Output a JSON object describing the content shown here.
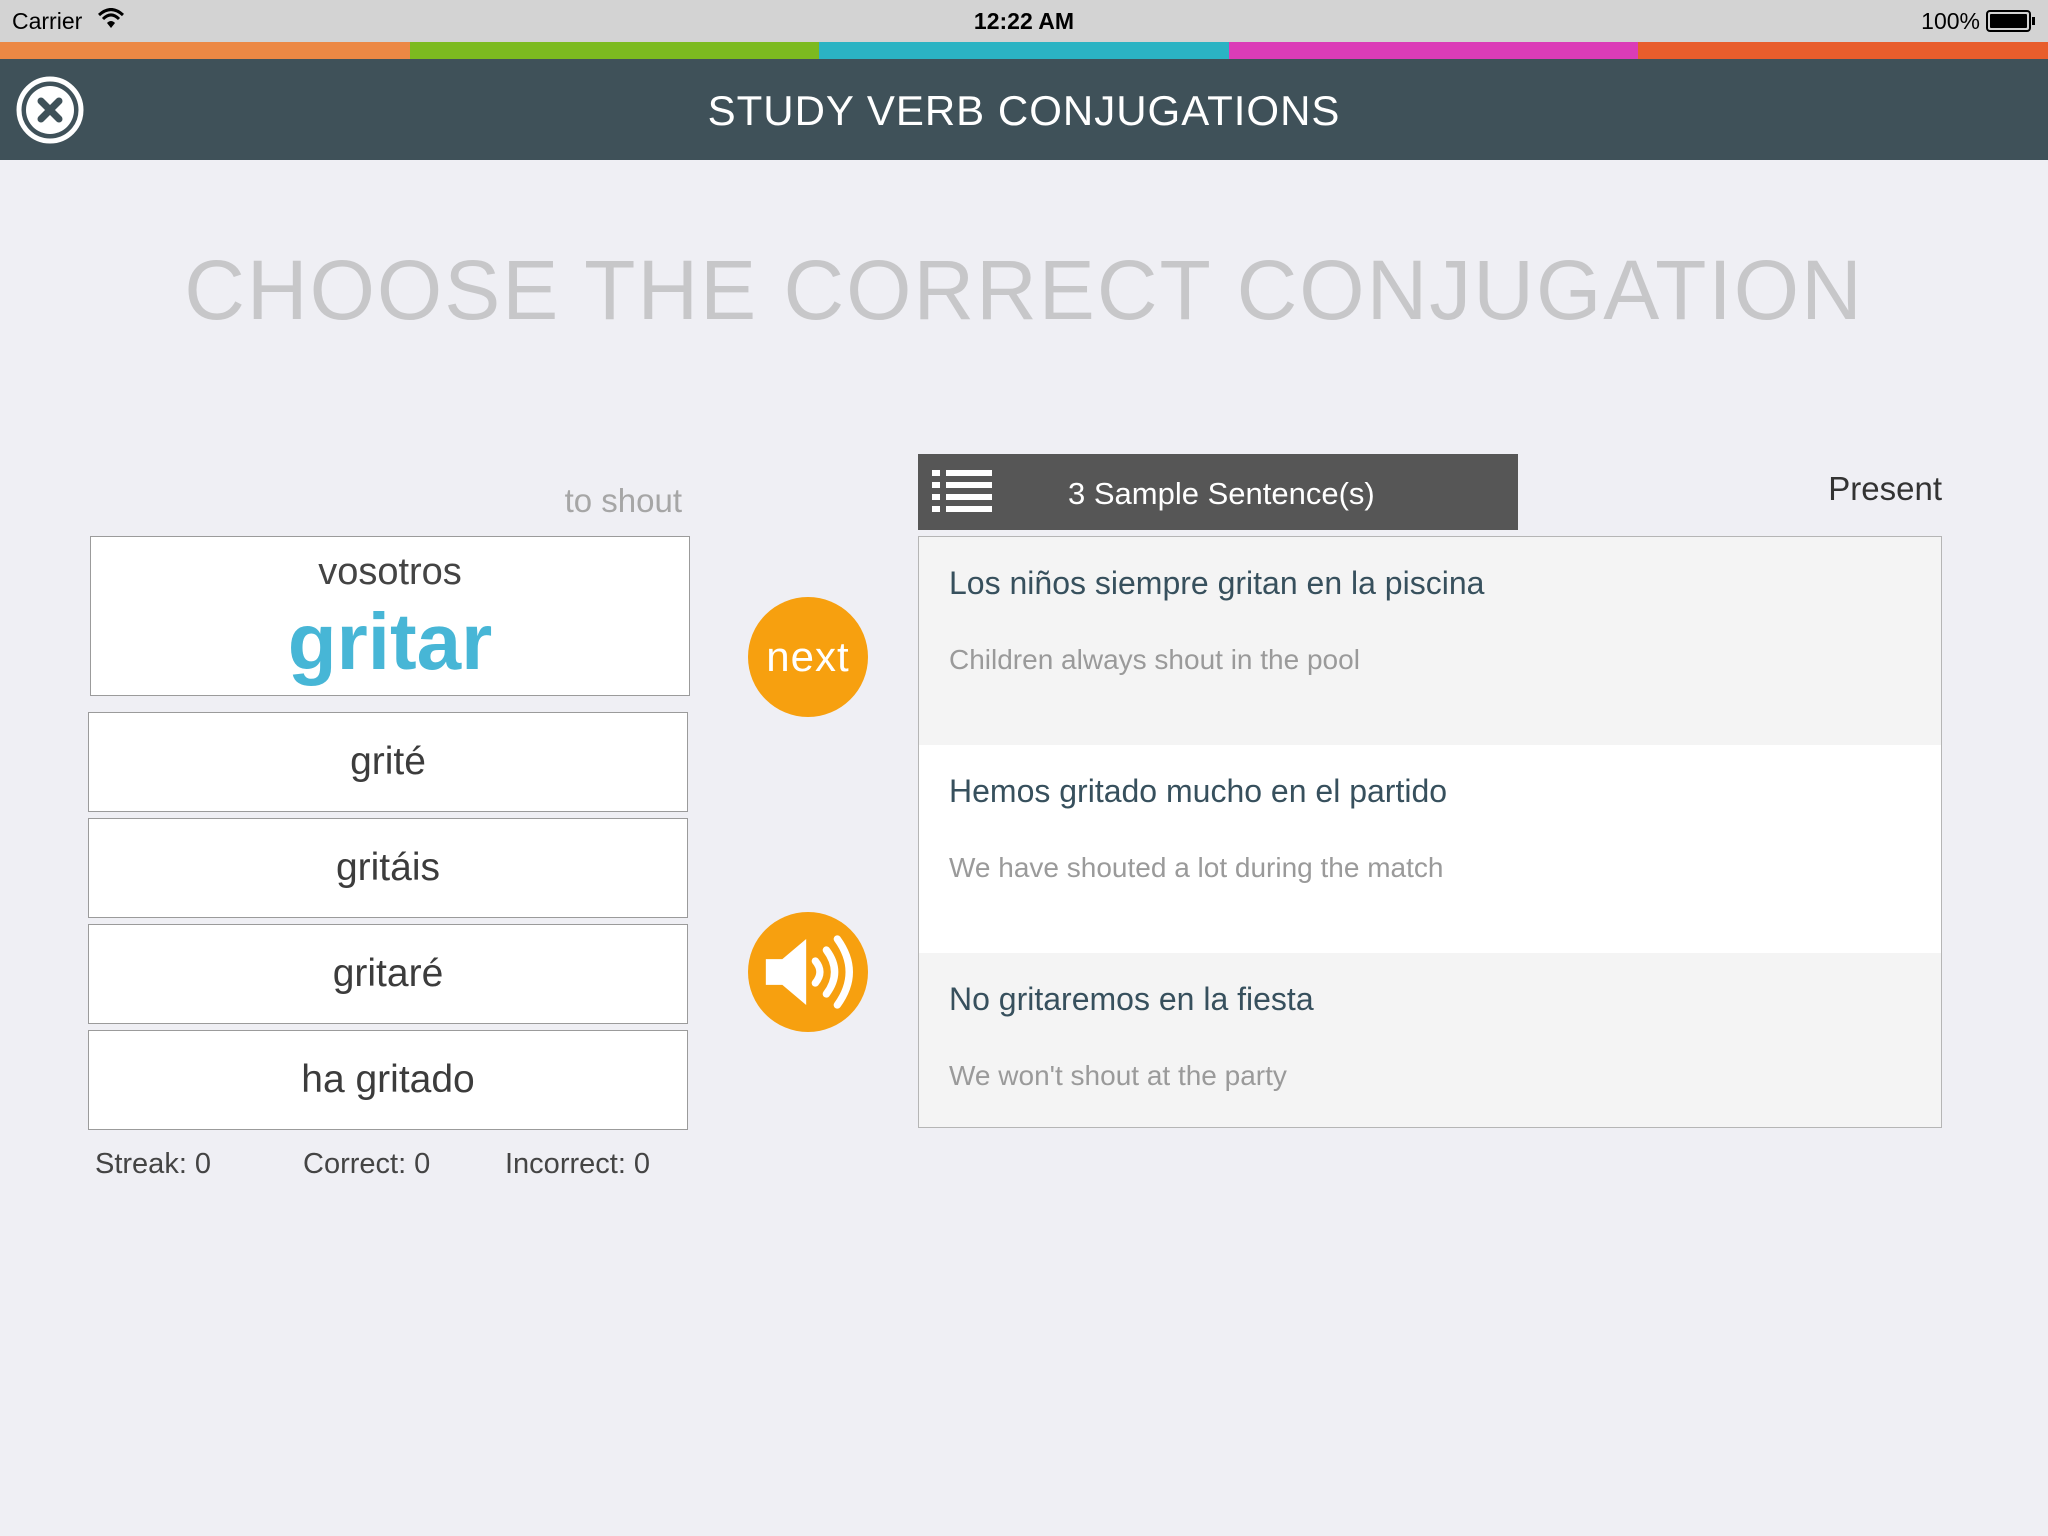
{
  "status_bar": {
    "carrier": "Carrier",
    "time": "12:22 AM",
    "battery": "100%"
  },
  "color_strip": [
    "#ec8844",
    "#7cba20",
    "#2bb3c3",
    "#db3cb7",
    "#e85d2c"
  ],
  "header": {
    "title": "STUDY VERB CONJUGATIONS",
    "close_icon": "close-x-circle-icon"
  },
  "heading": "CHOOSE THE CORRECT CONJUGATION",
  "prompt": {
    "translation": "to shout",
    "pronoun": "vosotros",
    "verb": "gritar"
  },
  "options": [
    "grité",
    "gritáis",
    "gritaré",
    "ha gritado"
  ],
  "stats": {
    "streak": "Streak: 0",
    "correct": "Correct: 0",
    "incorrect": "Incorrect: 0"
  },
  "buttons": {
    "next": "next",
    "audio_icon": "speaker-icon"
  },
  "sentences": {
    "tab_label": "3 Sample Sentence(s)",
    "list_icon": "list-icon",
    "tense": "Present",
    "items": [
      {
        "es": "Los niños siempre gritan en la piscina",
        "en": "Children always shout in the pool"
      },
      {
        "es": "Hemos gritado mucho en el partido",
        "en": "We have shouted a lot during the match"
      },
      {
        "es": "No gritaremos en la fiesta",
        "en": "We won't shout at the party"
      }
    ]
  },
  "colors": {
    "header_bg": "#3f5159",
    "accent_orange": "#f7a00f",
    "verb_blue": "#47b6d6"
  }
}
